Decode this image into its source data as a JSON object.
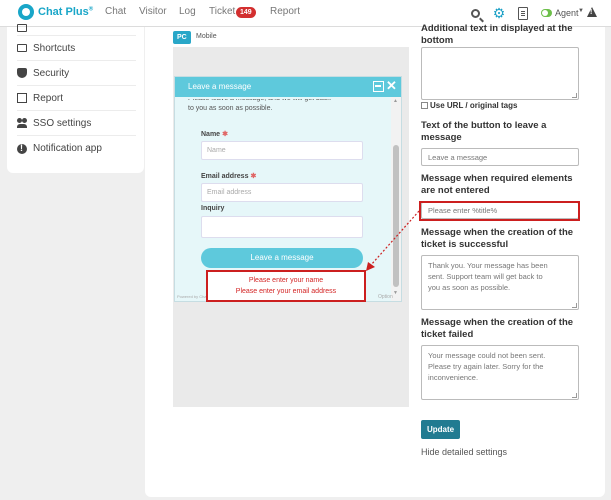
{
  "topbar": {
    "brand": "Chat Plus",
    "brand_mark": "®",
    "nav": [
      "Chat",
      "Visitor",
      "Log",
      "Ticket",
      "Report"
    ],
    "ticket_badge": "149",
    "agent_label": "Agent",
    "agent_caret": "▼",
    "icons": [
      "search-icon",
      "gear-icon",
      "document-icon",
      "toggle-icon",
      "warning-icon"
    ]
  },
  "sidebar": {
    "items": [
      {
        "label": "Shortcuts",
        "icon": "monitor-icon"
      },
      {
        "label": "Security",
        "icon": "shield-icon"
      },
      {
        "label": "Report",
        "icon": "report-icon"
      },
      {
        "label": "SSO settings",
        "icon": "users-icon"
      },
      {
        "label": "Notification app",
        "icon": "info-icon"
      }
    ]
  },
  "preview": {
    "tab_pc": "PC",
    "tab_mobile": "Mobile",
    "widget_title": "Leave a message",
    "intro_line1": "Please leave a message, and we will get back",
    "intro_line2": "to you as soon as possible.",
    "name_label": "Name",
    "name_placeholder": "Name",
    "email_label": "Email address",
    "email_placeholder": "Email address",
    "inquiry_label": "Inquiry",
    "required_mark": "✱",
    "button_label": "Leave a message",
    "powered_by": "Powered by Chat Plus",
    "option_text": "Option",
    "errors": [
      "Please enter your name",
      "Please enter your email address"
    ],
    "highlight_color": "#cc1f1f",
    "accent_color": "#5ec9dc"
  },
  "settings": {
    "thanks_label_1": "Additional text in displayed at the",
    "thanks_label_2": "bottom",
    "use_url_label": "Use URL / original tags",
    "button_text_label_1": "Text of the button to leave a",
    "button_text_label_2": "message",
    "button_text_value": "Leave a message",
    "required_msg_label_1": "Message when required elements",
    "required_msg_label_2": "are not entered",
    "required_msg_value": "Please enter %title%",
    "success_label_1": "Message when the creation of the",
    "success_label_2": "ticket is successful",
    "success_line1": "Thank you. Your message has been",
    "success_line2": "sent. Support team will get back to",
    "success_line3": "you as soon as possible.",
    "failed_label_1": "Message when the creation of the",
    "failed_label_2": "ticket failed",
    "failed_line1": "Your message could not been sent.",
    "failed_line2": "Please try again later. Sorry for the",
    "failed_line3": "inconvenience.",
    "update_button": "Update",
    "hide_link": "Hide detailed settings"
  }
}
